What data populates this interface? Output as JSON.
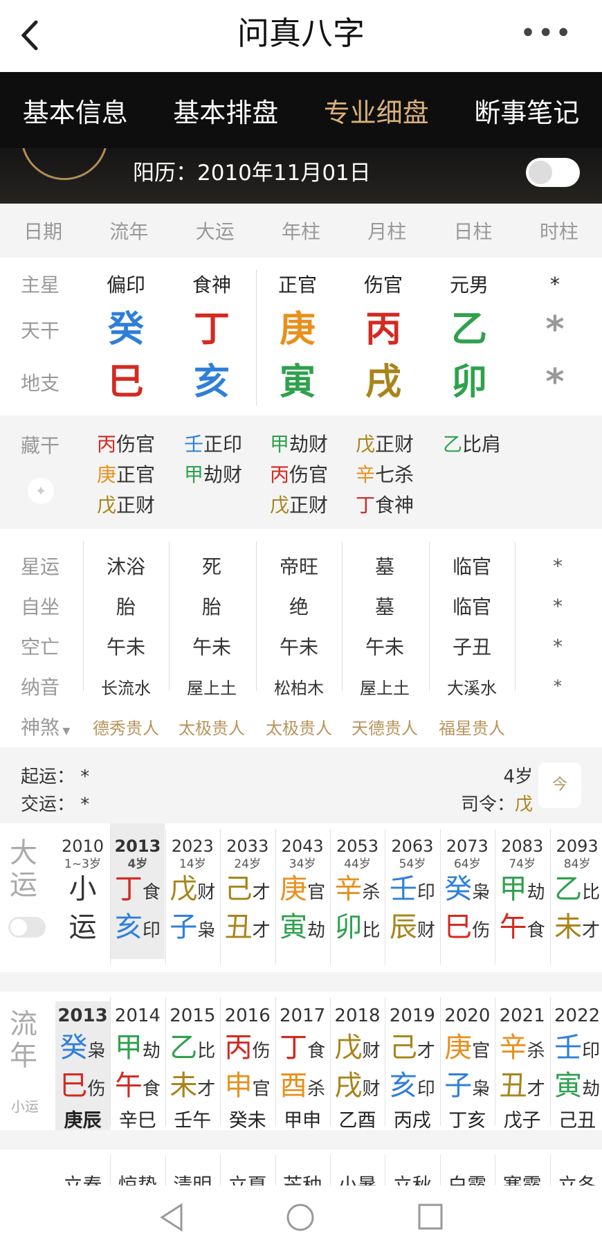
{
  "header": {
    "title": "问真八字"
  },
  "tabs": [
    "基本信息",
    "基本排盘",
    "专业细盘",
    "断事笔记"
  ],
  "solar": "阳历：2010年11月01日",
  "columns": [
    "日期",
    "流年",
    "大运",
    "年柱",
    "月柱",
    "日柱",
    "时柱"
  ],
  "row_labels": {
    "zhuxing": "主星",
    "tiangan": "天干",
    "dizhi": "地支",
    "canggan": "藏干",
    "xingyun": "星运",
    "zizuo": "自坐",
    "kongwang": "空亡",
    "nayin": "纳音",
    "shensha": "神煞"
  },
  "zhuxing": [
    "偏印",
    "食神",
    "正官",
    "伤官",
    "元男",
    "*"
  ],
  "tiangan": [
    {
      "c": "癸",
      "color": "#2f7fd9"
    },
    {
      "c": "丁",
      "color": "#d42a20"
    },
    {
      "c": "庚",
      "color": "#e8901c"
    },
    {
      "c": "丙",
      "color": "#d42a20"
    },
    {
      "c": "乙",
      "color": "#2fa14d"
    },
    {
      "c": "*",
      "color": "#999"
    }
  ],
  "dizhi": [
    {
      "c": "巳",
      "color": "#d42a20"
    },
    {
      "c": "亥",
      "color": "#2f7fd9"
    },
    {
      "c": "寅",
      "color": "#2fa14d"
    },
    {
      "c": "戌",
      "color": "#a8841a"
    },
    {
      "c": "卯",
      "color": "#2fa14d"
    },
    {
      "c": "*",
      "color": "#999"
    }
  ],
  "canggan": [
    [
      {
        "g": "丙",
        "color": "#d42a20",
        "s": "伤官"
      },
      {
        "g": "庚",
        "color": "#e8901c",
        "s": "正官"
      },
      {
        "g": "戊",
        "color": "#a8841a",
        "s": "正财"
      }
    ],
    [
      {
        "g": "壬",
        "color": "#2f7fd9",
        "s": "正印"
      },
      {
        "g": "甲",
        "color": "#2fa14d",
        "s": "劫财"
      }
    ],
    [
      {
        "g": "甲",
        "color": "#2fa14d",
        "s": "劫财"
      },
      {
        "g": "丙",
        "color": "#d42a20",
        "s": "伤官"
      },
      {
        "g": "戊",
        "color": "#a8841a",
        "s": "正财"
      }
    ],
    [
      {
        "g": "戊",
        "color": "#a8841a",
        "s": "正财"
      },
      {
        "g": "辛",
        "color": "#e8901c",
        "s": "七杀"
      },
      {
        "g": "丁",
        "color": "#d42a20",
        "s": "食神"
      }
    ],
    [
      {
        "g": "乙",
        "color": "#2fa14d",
        "s": "比肩"
      }
    ]
  ],
  "xingyun": [
    "沐浴",
    "死",
    "帝旺",
    "墓",
    "临官",
    "*"
  ],
  "zizuo": [
    "胎",
    "胎",
    "绝",
    "墓",
    "临官",
    "*"
  ],
  "kongwang": [
    "午未",
    "午未",
    "午未",
    "午未",
    "子丑",
    "*"
  ],
  "nayin": [
    "长流水",
    "屋上土",
    "松柏木",
    "屋上土",
    "大溪水",
    "*"
  ],
  "shensha": [
    "德秀贵人",
    "太极贵人",
    "太极贵人",
    "天德贵人",
    "福星贵人"
  ],
  "qiyun": {
    "qi": "起运：  *",
    "jiao": "交运：  *",
    "age": "4岁",
    "siling_label": "司令：",
    "siling": "戊",
    "jin": "今"
  },
  "dayun_label": [
    "大",
    "运"
  ],
  "dayun": [
    {
      "yr": "2010",
      "ag": "1~3岁",
      "top": {
        "c": "小",
        "cl": "#333",
        "s": ""
      },
      "bot": {
        "c": "运",
        "cl": "#333",
        "s": ""
      }
    },
    {
      "yr": "2013",
      "ag": "4岁",
      "top": {
        "c": "丁",
        "cl": "#d42a20",
        "s": "食"
      },
      "bot": {
        "c": "亥",
        "cl": "#2f7fd9",
        "s": "印"
      }
    },
    {
      "yr": "2023",
      "ag": "14岁",
      "top": {
        "c": "戊",
        "cl": "#a8841a",
        "s": "财"
      },
      "bot": {
        "c": "子",
        "cl": "#2f7fd9",
        "s": "枭"
      }
    },
    {
      "yr": "2033",
      "ag": "24岁",
      "top": {
        "c": "己",
        "cl": "#a8841a",
        "s": "才"
      },
      "bot": {
        "c": "丑",
        "cl": "#a8841a",
        "s": "才"
      }
    },
    {
      "yr": "2043",
      "ag": "34岁",
      "top": {
        "c": "庚",
        "cl": "#e8901c",
        "s": "官"
      },
      "bot": {
        "c": "寅",
        "cl": "#2fa14d",
        "s": "劫"
      }
    },
    {
      "yr": "2053",
      "ag": "44岁",
      "top": {
        "c": "辛",
        "cl": "#e8901c",
        "s": "杀"
      },
      "bot": {
        "c": "卯",
        "cl": "#2fa14d",
        "s": "比"
      }
    },
    {
      "yr": "2063",
      "ag": "54岁",
      "top": {
        "c": "壬",
        "cl": "#2f7fd9",
        "s": "印"
      },
      "bot": {
        "c": "辰",
        "cl": "#a8841a",
        "s": "财"
      }
    },
    {
      "yr": "2073",
      "ag": "64岁",
      "top": {
        "c": "癸",
        "cl": "#2f7fd9",
        "s": "枭"
      },
      "bot": {
        "c": "巳",
        "cl": "#d42a20",
        "s": "伤"
      }
    },
    {
      "yr": "2083",
      "ag": "74岁",
      "top": {
        "c": "甲",
        "cl": "#2fa14d",
        "s": "劫"
      },
      "bot": {
        "c": "午",
        "cl": "#d42a20",
        "s": "食"
      }
    },
    {
      "yr": "2093",
      "ag": "84岁",
      "top": {
        "c": "乙",
        "cl": "#2fa14d",
        "s": "比"
      },
      "bot": {
        "c": "未",
        "cl": "#a8841a",
        "s": "才"
      }
    }
  ],
  "liunian_label": [
    "流",
    "年"
  ],
  "xiaoyun_label": "小运",
  "liunian": [
    {
      "yr": "2013",
      "top": {
        "c": "癸",
        "cl": "#2f7fd9",
        "s": "枭"
      },
      "bot": {
        "c": "巳",
        "cl": "#d42a20",
        "s": "伤"
      },
      "xy": "庚辰"
    },
    {
      "yr": "2014",
      "top": {
        "c": "甲",
        "cl": "#2fa14d",
        "s": "劫"
      },
      "bot": {
        "c": "午",
        "cl": "#d42a20",
        "s": "食"
      },
      "xy": "辛巳"
    },
    {
      "yr": "2015",
      "top": {
        "c": "乙",
        "cl": "#2fa14d",
        "s": "比"
      },
      "bot": {
        "c": "未",
        "cl": "#a8841a",
        "s": "才"
      },
      "xy": "壬午"
    },
    {
      "yr": "2016",
      "top": {
        "c": "丙",
        "cl": "#d42a20",
        "s": "伤"
      },
      "bot": {
        "c": "申",
        "cl": "#e8901c",
        "s": "官"
      },
      "xy": "癸未"
    },
    {
      "yr": "2017",
      "top": {
        "c": "丁",
        "cl": "#d42a20",
        "s": "食"
      },
      "bot": {
        "c": "酉",
        "cl": "#e8901c",
        "s": "杀"
      },
      "xy": "甲申"
    },
    {
      "yr": "2018",
      "top": {
        "c": "戊",
        "cl": "#a8841a",
        "s": "财"
      },
      "bot": {
        "c": "戌",
        "cl": "#a8841a",
        "s": "财"
      },
      "xy": "乙酉"
    },
    {
      "yr": "2019",
      "top": {
        "c": "己",
        "cl": "#a8841a",
        "s": "才"
      },
      "bot": {
        "c": "亥",
        "cl": "#2f7fd9",
        "s": "印"
      },
      "xy": "丙戌"
    },
    {
      "yr": "2020",
      "top": {
        "c": "庚",
        "cl": "#e8901c",
        "s": "官"
      },
      "bot": {
        "c": "子",
        "cl": "#2f7fd9",
        "s": "枭"
      },
      "xy": "丁亥"
    },
    {
      "yr": "2021",
      "top": {
        "c": "辛",
        "cl": "#e8901c",
        "s": "杀"
      },
      "bot": {
        "c": "丑",
        "cl": "#a8841a",
        "s": "才"
      },
      "xy": "戊子"
    },
    {
      "yr": "2022",
      "top": {
        "c": "壬",
        "cl": "#2f7fd9",
        "s": "印"
      },
      "bot": {
        "c": "寅",
        "cl": "#2fa14d",
        "s": "劫"
      },
      "xy": "己丑"
    }
  ],
  "jieqi": [
    "立春",
    "惊蛰",
    "清明",
    "立夏",
    "芒种",
    "小暑",
    "立秋",
    "白露",
    "寒露",
    "立冬"
  ]
}
